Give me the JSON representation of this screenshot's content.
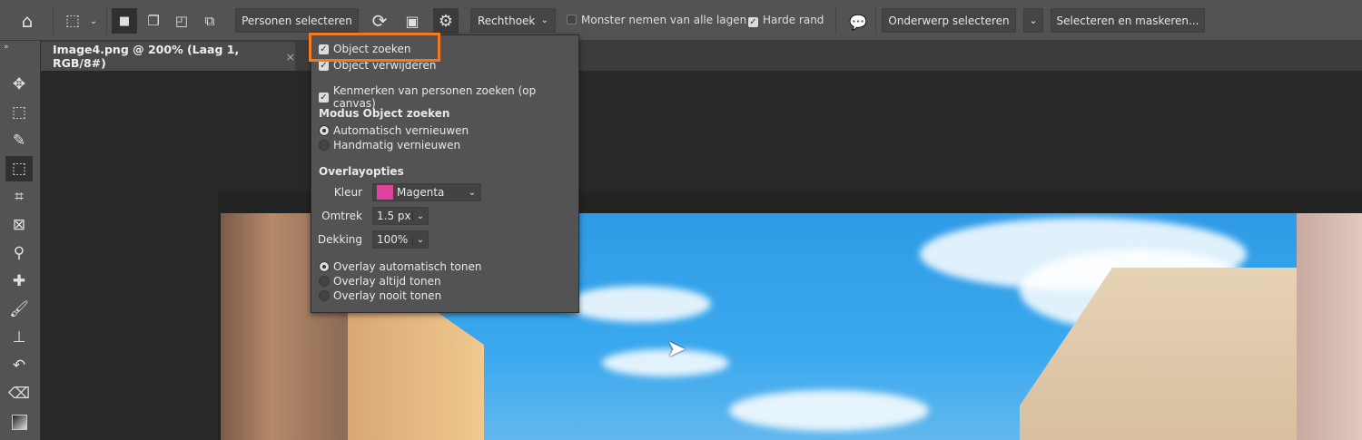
{
  "options_bar": {
    "person_select_label": "Personen selecteren",
    "shape_mode": "Rechthoek",
    "sample_all_layers": {
      "label": "Monster nemen van alle lagen",
      "checked": false
    },
    "hard_edge": {
      "label": "Harde rand",
      "checked": true
    },
    "select_subject_label": "Onderwerp selecteren",
    "select_and_mask_label": "Selecteren en maskeren..."
  },
  "document_tab": {
    "title": "Image4.png @ 200% (Laag 1, RGB/8#)",
    "close": "×"
  },
  "panel": {
    "object_finder": {
      "label": "Object zoeken",
      "checked": true
    },
    "object_remove": {
      "label": "Object verwijderen",
      "checked": true
    },
    "person_features": {
      "label": "Kenmerken van personen zoeken (op canvas)",
      "checked": true
    },
    "mode_heading": "Modus Object zoeken",
    "mode_options": [
      {
        "label": "Automatisch vernieuwen",
        "selected": true
      },
      {
        "label": "Handmatig vernieuwen",
        "selected": false
      }
    ],
    "overlay_heading": "Overlayopties",
    "color_label": "Kleur",
    "color_value": "Magenta",
    "color_swatch": "#e040a0",
    "outline_label": "Omtrek",
    "outline_value": "1.5 px",
    "opacity_label": "Dekking",
    "opacity_value": "100%",
    "overlay_options": [
      {
        "label": "Overlay automatisch tonen",
        "selected": true
      },
      {
        "label": "Overlay altijd tonen",
        "selected": false
      },
      {
        "label": "Overlay nooit tonen",
        "selected": false
      }
    ]
  },
  "highlight_color": "#f27b21"
}
